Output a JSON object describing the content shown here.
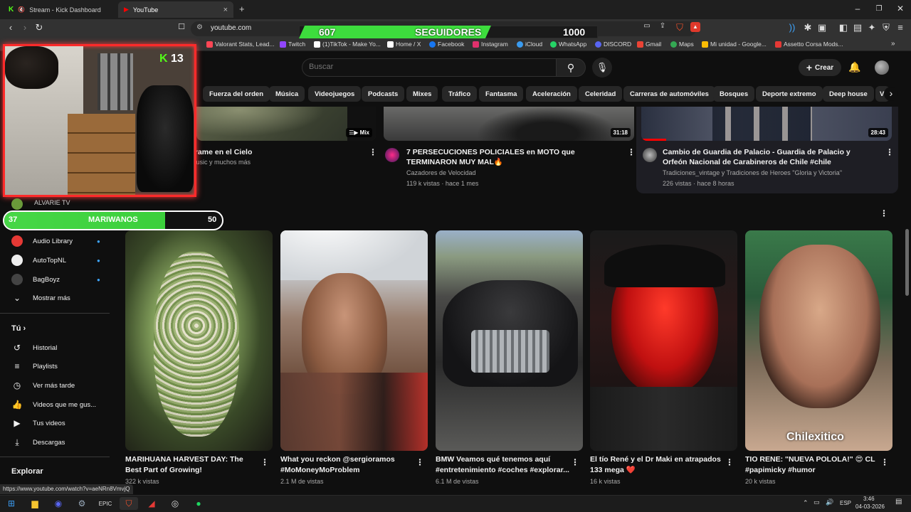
{
  "browser": {
    "tabs": [
      {
        "label": "Stream - Kick Dashboard",
        "active": false
      },
      {
        "label": "YouTube",
        "active": true
      }
    ],
    "new_tab": "+",
    "url": "youtube.com",
    "status_url": "https://www.youtube.com/watch?v=aeNRn8VmvjQ",
    "bookmarks": [
      {
        "label": "Valorant Stats, Lead...",
        "color": "#ff4655"
      },
      {
        "label": "Twitch",
        "color": "#9146ff"
      },
      {
        "label": "(1)TikTok - Make Yo...",
        "color": "#ffffff"
      },
      {
        "label": "Home / X",
        "color": "#ffffff"
      },
      {
        "label": "Facebook",
        "color": "#1877f2"
      },
      {
        "label": "Instagram",
        "color": "#e1306c"
      },
      {
        "label": "iCloud",
        "color": "#3a9bf0"
      },
      {
        "label": "WhatsApp",
        "color": "#25d366"
      },
      {
        "label": "DISCORD",
        "color": "#5865f2"
      },
      {
        "label": "Gmail",
        "color": "#ea4335"
      },
      {
        "label": "Maps",
        "color": "#34a853"
      },
      {
        "label": "Mi unidad - Google...",
        "color": "#fbbc04"
      },
      {
        "label": "Assetto Corsa Mods...",
        "color": "#e53935"
      }
    ]
  },
  "overlay": {
    "followers_current": "607",
    "followers_label": "SEGUIDORES",
    "followers_goal": "1000",
    "followers_progress": 0.607,
    "kick_count": "13",
    "sub_goal_current": "37",
    "sub_goal_label": "MARIWANOS",
    "sub_goal_target": "50",
    "sub_goal_progress": 0.74,
    "cam_name": "ALVARIE TV"
  },
  "youtube": {
    "search_placeholder": "Buscar",
    "create_label": "Crear",
    "chips": [
      "Fuerza del orden",
      "Música",
      "Videojuegos",
      "Podcasts",
      "Mixes",
      "Tráfico",
      "Fantasma",
      "Aceleración",
      "Celeridad",
      "Carreras de automóviles",
      "Bosques",
      "Deporte extremo",
      "Deep house",
      "V"
    ],
    "top_videos": [
      {
        "title": "érame en el Cielo",
        "meta1": "music y muchos más",
        "meta2": "",
        "badge": "Mix"
      },
      {
        "title": "7 PERSECUCIONES POLICIALES en MOTO que TERMINARON MUY MAL🔥",
        "meta1": "Cazadores de Velocidad",
        "meta2": "119 k vistas · hace 1 mes",
        "badge": "31:18"
      },
      {
        "title": "Cambio de Guardia de Palacio - Guardia de Palacio y Orfeón Nacional de Carabineros de Chile #chile",
        "meta1": "Tradiciones_vintage y Tradiciones de Heroes \"Gloria y Victoria\"",
        "meta2": "226 vistas · hace 8 horas",
        "badge": "28:43"
      }
    ],
    "shorts_header": "rts",
    "shorts": [
      {
        "title": "MARIHUANA HARVEST DAY: The Best Part of Growing!",
        "views": "322 k vistas"
      },
      {
        "title": "What you reckon @sergioramos #MoMoneyMoProblem",
        "views": "2.1 M de vistas"
      },
      {
        "title": "BMW Veamos qué tenemos aquí #entretenimiento #coches #explorar...",
        "views": "6.1 M de vistas"
      },
      {
        "title": "El tío René y el Dr Maki en atrapados 133 mega ❤️",
        "views": "16 k vistas"
      },
      {
        "title": "TIO RENE: \"NUEVA POLOLA!\" 😍 CL #papimicky #humor",
        "views": "20 k vistas"
      }
    ],
    "short_watermark": "Chilexitico",
    "subscriptions": [
      {
        "label": "Audio Library",
        "color": "#e53935"
      },
      {
        "label": "AutoTopNL",
        "color": "#ffffff"
      },
      {
        "label": "BagBoyz",
        "color": "#444444"
      }
    ],
    "show_more": "Mostrar más",
    "you_header": "Tú",
    "you_items": [
      {
        "label": "Historial",
        "icon": "history-icon"
      },
      {
        "label": "Playlists",
        "icon": "playlists-icon"
      },
      {
        "label": "Ver más tarde",
        "icon": "clock-icon"
      },
      {
        "label": "Videos que me gus...",
        "icon": "thumbs-up-icon"
      },
      {
        "label": "Tus videos",
        "icon": "video-icon"
      },
      {
        "label": "Descargas",
        "icon": "download-icon"
      }
    ],
    "explore_header": "Explorar"
  },
  "taskbar": {
    "lang": "ESP",
    "time": "3:46",
    "date": "04-03-2026"
  }
}
